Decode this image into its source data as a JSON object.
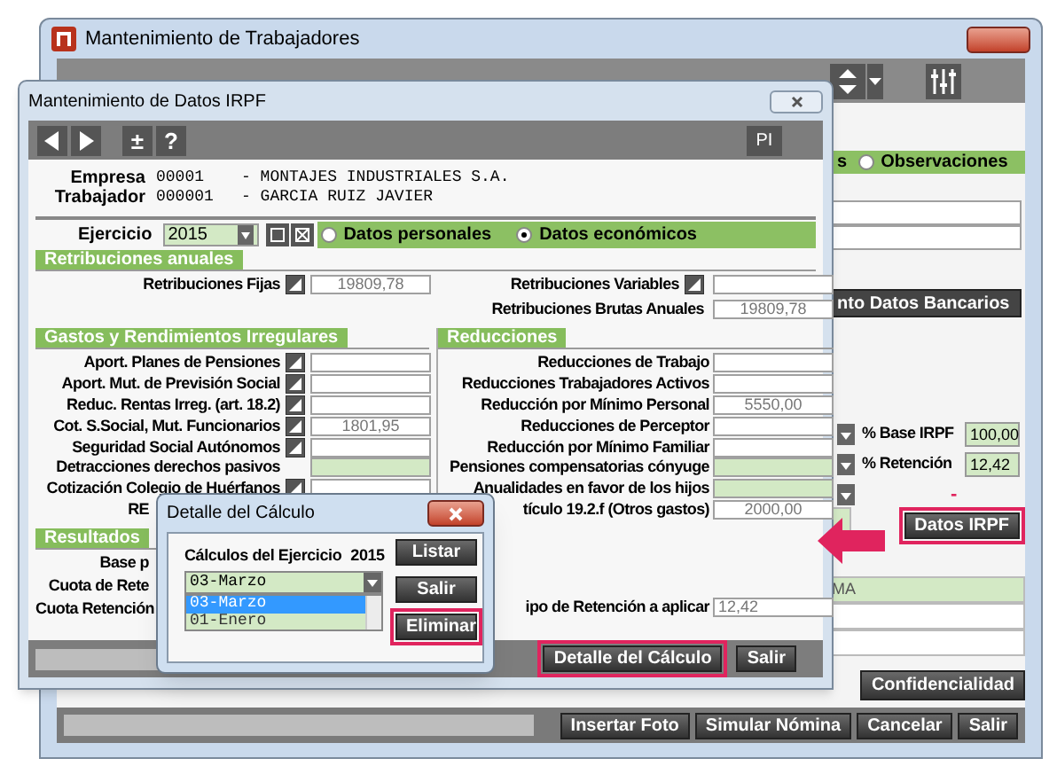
{
  "back_window": {
    "title": "Mantenimiento de Trabajadores",
    "tab_label_cut": "s",
    "observaciones": {
      "label": "Observaciones",
      "selected": false
    },
    "fields_top": [
      {
        "readonly": false
      },
      {
        "readonly": false
      }
    ],
    "bank_button": "nto Datos Bancarios",
    "rates": [
      {
        "kind": "rate",
        "label": "% Base IRPF",
        "value": "100,00"
      },
      {
        "kind": "rate",
        "label": "% Retención",
        "value": "12,42"
      },
      {
        "kind": "dash",
        "label": "-"
      }
    ],
    "irpf_button": {
      "label": "Datos IRPF",
      "highlighted": true
    },
    "fields_bottom": [
      {
        "value": "MA",
        "readonly": true
      },
      {
        "readonly": false
      },
      {
        "readonly": false
      }
    ],
    "confidentiality_button": "Confidencialidad",
    "footer_buttons": [
      "Insertar Foto",
      "Simular Nómina",
      "Cancelar",
      "Salir"
    ]
  },
  "irpf_window": {
    "title": "Mantenimiento de Datos IRPF",
    "toolbar_symbols": [
      "±",
      "?"
    ],
    "toolbar_right": "PI",
    "header": [
      {
        "label": "Empresa",
        "code": "00001",
        "name": "- MONTAJES INDUSTRIALES S.A."
      },
      {
        "label": "Trabajador",
        "code": "000001",
        "name": "- GARCIA RUIZ JAVIER"
      }
    ],
    "year": {
      "label": "Ejercicio",
      "value": "2015"
    },
    "modes": [
      {
        "label": "Datos personales",
        "selected": false
      },
      {
        "label": "Datos económicos",
        "selected": true
      }
    ],
    "annual": {
      "title": "Retribuciones anuales",
      "left": [
        {
          "label": "Retribuciones Fijas",
          "button": true,
          "value": "19809,78",
          "readonly": false
        }
      ],
      "right": [
        {
          "label": "Retribuciones Variables",
          "button": true,
          "readonly": false
        },
        {
          "label": "Retribuciones Brutas Anuales",
          "button": false,
          "value": "19809,78",
          "readonly": false
        }
      ]
    },
    "expenses": {
      "title": "Gastos y Rendimientos Irregulares",
      "rows": [
        {
          "label": "Aport. Planes de Pensiones",
          "button": true,
          "readonly": false,
          "cut": false
        },
        {
          "label": "Aport. Mut. de Previsión Social",
          "button": true,
          "readonly": false,
          "cut": false
        },
        {
          "label": "Reduc. Rentas Irreg. (art. 18.2)",
          "button": true,
          "readonly": false,
          "cut": false
        },
        {
          "label": "Cot. S.Social, Mut. Funcionarios",
          "button": true,
          "value": "1801,95",
          "readonly": false,
          "cut": false
        },
        {
          "label": "Seguridad Social Autónomos",
          "button": true,
          "readonly": false,
          "cut": false
        },
        {
          "label": "Detracciones derechos pasivos",
          "button": false,
          "readonly": true,
          "cut": false
        },
        {
          "label": "Cotización Colegio de Huérfanos",
          "button": true,
          "readonly": false,
          "cut": false
        },
        {
          "label": "RE",
          "cut": true
        }
      ]
    },
    "reductions": {
      "title": "Reducciones",
      "rows": [
        {
          "label": "Reducciones de Trabajo",
          "readonly": false
        },
        {
          "label": "Reducciones Trabajadores Activos",
          "readonly": false
        },
        {
          "label": "Reducción por Mínimo Personal",
          "value": "5550,00",
          "readonly": false
        },
        {
          "label": "Reducciones de Perceptor",
          "readonly": false
        },
        {
          "label": "Reducción por Mínimo Familiar",
          "readonly": false
        },
        {
          "label": "Pensiones compensatorias cónyuge",
          "readonly": true
        },
        {
          "label": "Anualidades en favor de los hijos",
          "readonly": true
        },
        {
          "label": "tículo 19.2.f (Otros gastos)",
          "value": "2000,00",
          "readonly": false
        }
      ]
    },
    "results": {
      "title": "Resultados",
      "left": [
        {
          "label": "Base p"
        },
        {
          "label": "Cuota de Rete"
        },
        {
          "label": "Cuota Retención"
        }
      ],
      "right": {
        "label": "ipo de Retención a aplicar",
        "value": "12,42",
        "readonly": false
      }
    },
    "footer_buttons": [
      {
        "label": "Detalle del Cálculo",
        "highlighted": true
      },
      {
        "label": "Salir",
        "highlighted": false
      }
    ]
  },
  "dialog": {
    "title": "Detalle del Cálculo",
    "label": "Cálculos del Ejercicio",
    "year": "2015",
    "select": "03-Marzo",
    "list": [
      {
        "label": "03-Marzo",
        "selected": true
      },
      {
        "label": "01-Enero",
        "selected": false
      }
    ],
    "buttons": [
      {
        "label": "Listar",
        "highlighted": false
      },
      {
        "label": "Salir",
        "highlighted": false
      },
      {
        "label": "Eliminar",
        "highlighted": true
      }
    ]
  }
}
